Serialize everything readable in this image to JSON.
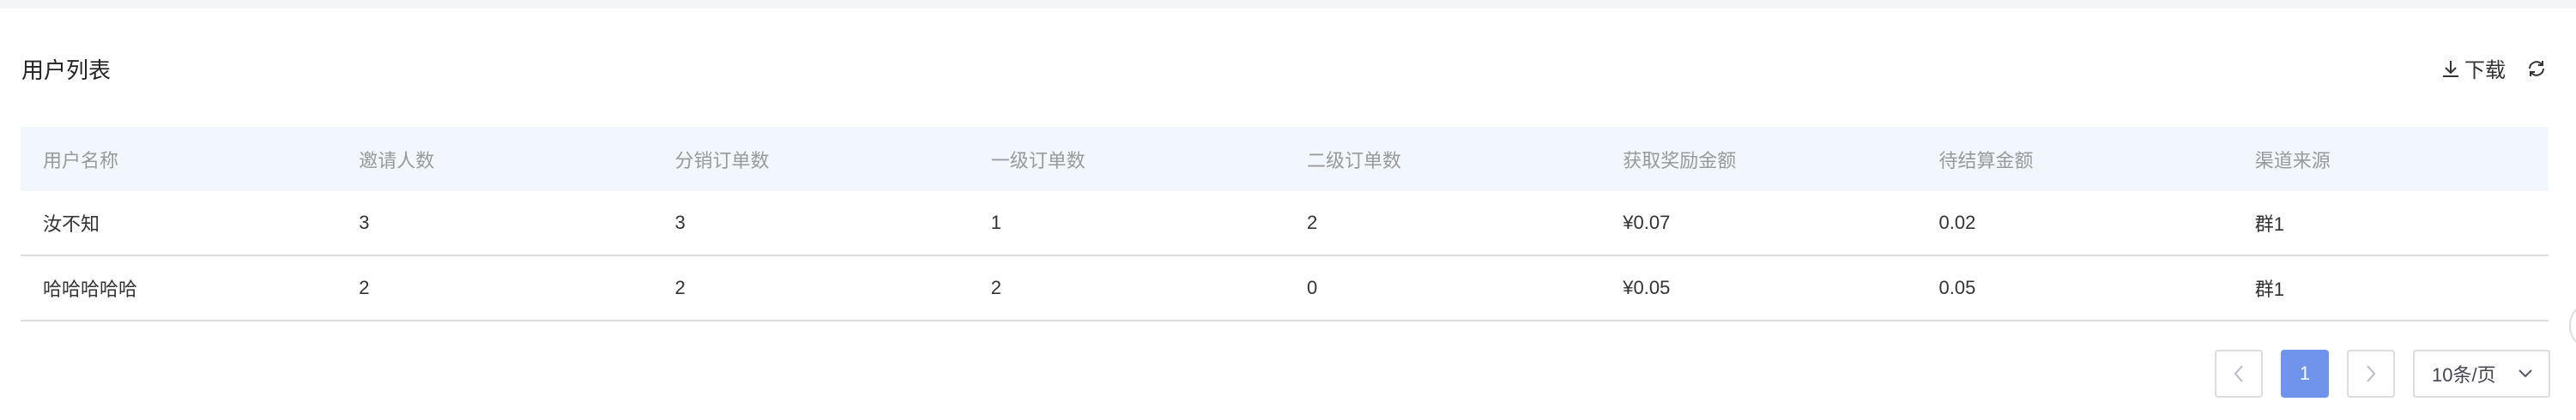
{
  "title": "用户列表",
  "toolbar": {
    "download_label": "下载",
    "download_icon": "download-icon",
    "refresh_icon": "refresh-icon"
  },
  "table": {
    "columns": [
      "用户名称",
      "邀请人数",
      "分销订单数",
      "一级订单数",
      "二级订单数",
      "获取奖励金额",
      "待结算金额",
      "渠道来源"
    ],
    "rows": [
      [
        "汝不知",
        "3",
        "3",
        "1",
        "2",
        "¥0.07",
        "0.02",
        "群1"
      ],
      [
        "哈哈哈哈哈",
        "2",
        "2",
        "2",
        "0",
        "¥0.05",
        "0.05",
        "群1"
      ]
    ]
  },
  "pagination": {
    "current_page": "1",
    "page_size": "10条/页"
  },
  "colors": {
    "accent": "#7094ec",
    "header_bg": "#f2f7fe"
  }
}
